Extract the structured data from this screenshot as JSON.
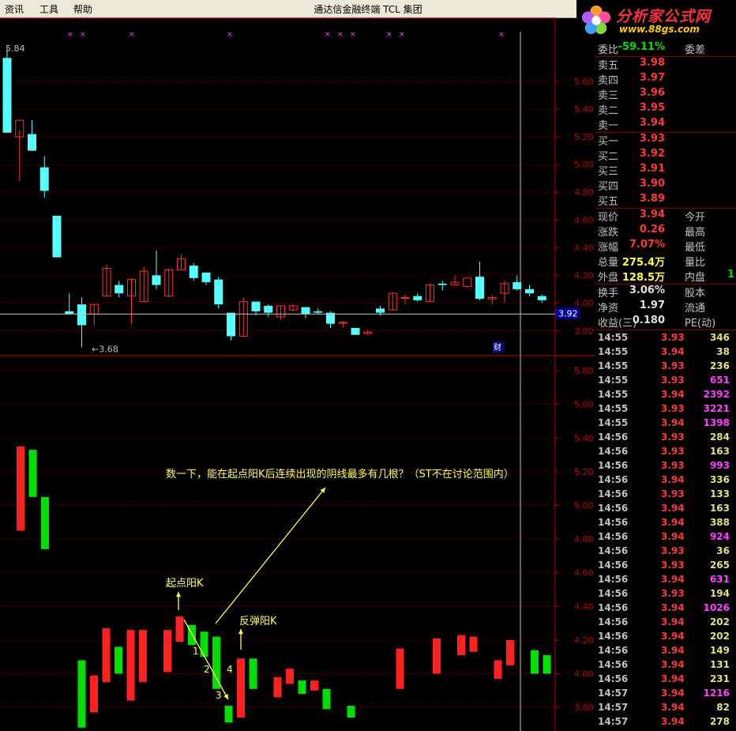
{
  "menu": [
    "资讯",
    "工具",
    "帮助"
  ],
  "app_title": "通达信金融终端  TCL 集团",
  "logo": {
    "brand": "分析家公式网",
    "url": "www.88gs.com"
  },
  "chart": {
    "top_pane": {
      "axis_ticks": [
        "5.60",
        "5.40",
        "5.20",
        "5.00",
        "4.80",
        "4.60",
        "4.40",
        "4.20",
        "4.00",
        "3.80"
      ],
      "axis_tick_values": [
        5.6,
        5.4,
        5.2,
        5.0,
        4.8,
        4.6,
        4.4,
        4.2,
        4.0,
        3.8
      ],
      "price_range": [
        3.62,
        5.92
      ],
      "high_label": "5.84",
      "low_label": "3.68",
      "current_price_tag": "3.92",
      "current_price": 3.92,
      "finance_marker": "财",
      "candles": [
        {
          "o": 5.77,
          "h": 5.84,
          "l": 5.23,
          "c": 5.23
        },
        {
          "o": 5.2,
          "h": 5.25,
          "l": 4.88,
          "c": 5.32
        },
        {
          "o": 5.22,
          "h": 5.32,
          "l": 5.17,
          "c": 5.1
        },
        {
          "o": 4.98,
          "h": 5.06,
          "l": 4.76,
          "c": 4.81
        },
        {
          "o": 4.63,
          "h": 4.63,
          "l": 4.33,
          "c": 4.33
        },
        {
          "o": 3.94,
          "h": 4.07,
          "l": 3.92,
          "c": 3.92
        },
        {
          "o": 3.99,
          "h": 4.04,
          "l": 3.68,
          "c": 3.84
        },
        {
          "o": 3.92,
          "h": 3.99,
          "l": 3.84,
          "c": 3.99
        },
        {
          "o": 4.05,
          "h": 4.28,
          "l": 4.05,
          "c": 4.25
        },
        {
          "o": 4.13,
          "h": 4.16,
          "l": 4.04,
          "c": 4.07
        },
        {
          "o": 4.05,
          "h": 4.18,
          "l": 3.85,
          "c": 4.17
        },
        {
          "o": 4.01,
          "h": 4.26,
          "l": 4.01,
          "c": 4.23
        },
        {
          "o": 4.2,
          "h": 4.38,
          "l": 4.1,
          "c": 4.13
        },
        {
          "o": 4.05,
          "h": 4.25,
          "l": 4.04,
          "c": 4.24
        },
        {
          "o": 4.24,
          "h": 4.35,
          "l": 4.24,
          "c": 4.32
        },
        {
          "o": 4.27,
          "h": 4.29,
          "l": 4.16,
          "c": 4.18
        },
        {
          "o": 4.22,
          "h": 4.2,
          "l": 4.13,
          "c": 4.15
        },
        {
          "o": 4.17,
          "h": 4.19,
          "l": 3.96,
          "c": 3.99
        },
        {
          "o": 3.93,
          "h": 3.93,
          "l": 3.73,
          "c": 3.76
        },
        {
          "o": 3.76,
          "h": 4.04,
          "l": 3.76,
          "c": 4.01
        },
        {
          "o": 4.01,
          "h": 4.01,
          "l": 3.91,
          "c": 3.94
        },
        {
          "o": 3.98,
          "h": 3.99,
          "l": 3.9,
          "c": 3.93
        },
        {
          "o": 3.9,
          "h": 3.98,
          "l": 3.88,
          "c": 3.98
        },
        {
          "o": 3.95,
          "h": 3.99,
          "l": 3.94,
          "c": 3.98
        },
        {
          "o": 3.97,
          "h": 3.96,
          "l": 3.89,
          "c": 3.92
        },
        {
          "o": 3.94,
          "h": 3.96,
          "l": 3.92,
          "c": 3.93
        },
        {
          "o": 3.93,
          "h": 3.94,
          "l": 3.82,
          "c": 3.85
        },
        {
          "o": 3.86,
          "h": 3.87,
          "l": 3.82,
          "c": 3.86
        },
        {
          "o": 3.82,
          "h": 3.82,
          "l": 3.77,
          "c": 3.77
        },
        {
          "o": 3.78,
          "h": 3.81,
          "l": 3.77,
          "c": 3.79
        },
        {
          "o": 3.96,
          "h": 3.98,
          "l": 3.91,
          "c": 3.93
        },
        {
          "o": 3.95,
          "h": 4.08,
          "l": 3.95,
          "c": 4.07
        },
        {
          "o": 4.04,
          "h": 4.06,
          "l": 3.99,
          "c": 4.04
        },
        {
          "o": 4.05,
          "h": 4.07,
          "l": 4.01,
          "c": 4.02
        },
        {
          "o": 4.01,
          "h": 4.14,
          "l": 4.01,
          "c": 4.13
        },
        {
          "o": 4.14,
          "h": 4.16,
          "l": 4.09,
          "c": 4.13
        },
        {
          "o": 4.13,
          "h": 4.2,
          "l": 4.13,
          "c": 4.15
        },
        {
          "o": 4.12,
          "h": 4.12,
          "l": 4.11,
          "c": 4.18
        },
        {
          "o": 4.19,
          "h": 4.3,
          "l": 4.02,
          "c": 4.03
        },
        {
          "o": 4.03,
          "h": 4.06,
          "l": 3.99,
          "c": 4.04
        },
        {
          "o": 4.07,
          "h": 4.16,
          "l": 4.0,
          "c": 4.14
        },
        {
          "o": 4.15,
          "h": 4.2,
          "l": 4.09,
          "c": 4.1
        },
        {
          "o": 4.1,
          "h": 4.13,
          "l": 4.05,
          "c": 4.07
        },
        {
          "o": 4.05,
          "h": 4.06,
          "l": 4.0,
          "c": 4.02
        }
      ]
    },
    "bottom_pane": {
      "axis_ticks": [
        "5.80",
        "5.60",
        "5.40",
        "5.20",
        "5.00",
        "4.80",
        "4.60",
        "4.40",
        "4.20",
        "4.00",
        "3.80"
      ],
      "axis_tick_values": [
        5.8,
        5.6,
        5.4,
        5.2,
        5.0,
        4.8,
        4.6,
        4.4,
        4.2,
        4.0,
        3.8
      ],
      "price_range": [
        3.66,
        5.88
      ],
      "bars": [
        {
          "top": 5.35,
          "bottom": 4.85,
          "color": "red"
        },
        {
          "top": 5.33,
          "bottom": 5.05,
          "color": "green"
        },
        {
          "top": 5.05,
          "bottom": 4.74,
          "color": "green"
        },
        null,
        null,
        {
          "top": 4.08,
          "bottom": 3.68,
          "color": "green"
        },
        {
          "top": 3.99,
          "bottom": 3.77,
          "color": "red"
        },
        {
          "top": 4.27,
          "bottom": 3.95,
          "color": "red"
        },
        {
          "top": 4.16,
          "bottom": 4.0,
          "color": "green"
        },
        {
          "top": 4.26,
          "bottom": 3.84,
          "color": "red"
        },
        {
          "top": 4.26,
          "bottom": 3.95,
          "color": "red"
        },
        null,
        {
          "top": 4.26,
          "bottom": 4.01,
          "color": "red"
        },
        {
          "top": 4.34,
          "bottom": 4.19,
          "color": "red"
        },
        {
          "top": 4.29,
          "bottom": 4.17,
          "color": "green"
        },
        {
          "top": 4.25,
          "bottom": 4.1,
          "color": "green"
        },
        {
          "top": 4.22,
          "bottom": 3.91,
          "color": "green"
        },
        {
          "top": 3.81,
          "bottom": 3.71,
          "color": "green"
        },
        {
          "top": 4.09,
          "bottom": 3.74,
          "color": "red"
        },
        {
          "top": 4.09,
          "bottom": 3.91,
          "color": "green"
        },
        null,
        {
          "top": 3.98,
          "bottom": 3.86,
          "color": "red"
        },
        {
          "top": 4.03,
          "bottom": 3.94,
          "color": "red"
        },
        {
          "top": 3.96,
          "bottom": 3.88,
          "color": "green"
        },
        {
          "top": 3.96,
          "bottom": 3.9,
          "color": "red"
        },
        {
          "top": 3.91,
          "bottom": 3.79,
          "color": "green"
        },
        null,
        {
          "top": 3.81,
          "bottom": 3.74,
          "color": "green"
        },
        null,
        null,
        null,
        {
          "top": 4.15,
          "bottom": 3.91,
          "color": "red"
        },
        null,
        null,
        {
          "top": 4.21,
          "bottom": 4.0,
          "color": "red"
        },
        null,
        {
          "top": 4.23,
          "bottom": 4.11,
          "color": "red"
        },
        {
          "top": 4.22,
          "bottom": 4.13,
          "color": "red"
        },
        null,
        {
          "top": 4.08,
          "bottom": 3.97,
          "color": "red"
        },
        {
          "top": 4.2,
          "bottom": 4.05,
          "color": "red"
        },
        null,
        {
          "top": 4.14,
          "bottom": 4.0,
          "color": "green"
        },
        {
          "top": 4.11,
          "bottom": 4.0,
          "color": "green"
        }
      ]
    },
    "annotations": {
      "question": "数一下，能在起点阳K后连续出现的阴线最多有几根？（ST不在讨论范围内）",
      "start_label": "起点阳K",
      "rebound_label": "反弹阳K",
      "counts": [
        "1",
        "2",
        "3",
        "4"
      ]
    },
    "colors": {
      "up": "#ff2020",
      "down": "#00e000",
      "candle_up": "#ff3030",
      "candle_down": "#54ffff",
      "axis": "#c00000",
      "annotation": "#ffff50"
    }
  },
  "quote": {
    "header": {
      "label": "委比",
      "value": "-59.11%",
      "label2": "委差"
    },
    "asks": [
      {
        "label": "卖五",
        "price": "3.98"
      },
      {
        "label": "卖四",
        "price": "3.97"
      },
      {
        "label": "卖三",
        "price": "3.96"
      },
      {
        "label": "卖二",
        "price": "3.95"
      },
      {
        "label": "卖一",
        "price": "3.94"
      }
    ],
    "bids": [
      {
        "label": "买一",
        "price": "3.93"
      },
      {
        "label": "买二",
        "price": "3.92"
      },
      {
        "label": "买三",
        "price": "3.91"
      },
      {
        "label": "买四",
        "price": "3.90"
      },
      {
        "label": "买五",
        "price": "3.89"
      }
    ],
    "stats": [
      {
        "label": "现价",
        "value": "3.94",
        "label2": "今开",
        "value2": ""
      },
      {
        "label": "涨跌",
        "value": "0.26",
        "label2": "最高",
        "value2": ""
      },
      {
        "label": "涨幅",
        "value": "7.07%",
        "label2": "最低",
        "value2": ""
      },
      {
        "label": "总量",
        "value": "275.4万",
        "label2": "量比",
        "value2": ""
      },
      {
        "label": "外盘",
        "value": "128.5万",
        "label2": "内盘",
        "value2": "1"
      }
    ],
    "stats2": [
      {
        "label": "换手",
        "value": "3.06%",
        "label2": "股本"
      },
      {
        "label": "净资",
        "value": "1.97",
        "label2": "流通"
      },
      {
        "label": "收益(三)",
        "value": "0.180",
        "label2": "PE(动)"
      }
    ],
    "ticks": [
      {
        "time": "14:55",
        "price": "3.93",
        "vol": "346",
        "pc": "red",
        "vc": "yel"
      },
      {
        "time": "14:55",
        "price": "3.94",
        "vol": "38",
        "pc": "red",
        "vc": "yel"
      },
      {
        "time": "14:55",
        "price": "3.93",
        "vol": "236",
        "pc": "red",
        "vc": "yel"
      },
      {
        "time": "14:55",
        "price": "3.93",
        "vol": "651",
        "pc": "red",
        "vc": "mag"
      },
      {
        "time": "14:55",
        "price": "3.94",
        "vol": "2392",
        "pc": "red",
        "vc": "mag"
      },
      {
        "time": "14:55",
        "price": "3.93",
        "vol": "3221",
        "pc": "red",
        "vc": "mag"
      },
      {
        "time": "14:55",
        "price": "3.94",
        "vol": "1398",
        "pc": "red",
        "vc": "mag"
      },
      {
        "time": "14:56",
        "price": "3.93",
        "vol": "284",
        "pc": "red",
        "vc": "yel"
      },
      {
        "time": "14:56",
        "price": "3.93",
        "vol": "163",
        "pc": "red",
        "vc": "yel"
      },
      {
        "time": "14:56",
        "price": "3.93",
        "vol": "993",
        "pc": "red",
        "vc": "mag"
      },
      {
        "time": "14:56",
        "price": "3.94",
        "vol": "336",
        "pc": "red",
        "vc": "yel"
      },
      {
        "time": "14:56",
        "price": "3.93",
        "vol": "133",
        "pc": "red",
        "vc": "yel"
      },
      {
        "time": "14:56",
        "price": "3.94",
        "vol": "163",
        "pc": "red",
        "vc": "yel"
      },
      {
        "time": "14:56",
        "price": "3.94",
        "vol": "388",
        "pc": "red",
        "vc": "yel"
      },
      {
        "time": "14:56",
        "price": "3.94",
        "vol": "924",
        "pc": "red",
        "vc": "mag"
      },
      {
        "time": "14:56",
        "price": "3.93",
        "vol": "36",
        "pc": "red",
        "vc": "yel"
      },
      {
        "time": "14:56",
        "price": "3.93",
        "vol": "265",
        "pc": "red",
        "vc": "yel"
      },
      {
        "time": "14:56",
        "price": "3.94",
        "vol": "631",
        "pc": "red",
        "vc": "mag"
      },
      {
        "time": "14:56",
        "price": "3.93",
        "vol": "194",
        "pc": "red",
        "vc": "yel"
      },
      {
        "time": "14:56",
        "price": "3.94",
        "vol": "1026",
        "pc": "red",
        "vc": "mag"
      },
      {
        "time": "14:56",
        "price": "3.94",
        "vol": "202",
        "pc": "red",
        "vc": "yel"
      },
      {
        "time": "14:56",
        "price": "3.94",
        "vol": "202",
        "pc": "red",
        "vc": "yel"
      },
      {
        "time": "14:56",
        "price": "3.94",
        "vol": "149",
        "pc": "red",
        "vc": "yel"
      },
      {
        "time": "14:56",
        "price": "3.94",
        "vol": "131",
        "pc": "red",
        "vc": "yel"
      },
      {
        "time": "14:56",
        "price": "3.94",
        "vol": "231",
        "pc": "red",
        "vc": "yel"
      },
      {
        "time": "14:57",
        "price": "3.94",
        "vol": "1216",
        "pc": "red",
        "vc": "mag"
      },
      {
        "time": "14:57",
        "price": "3.94",
        "vol": "82",
        "pc": "red",
        "vc": "yel"
      },
      {
        "time": "14:57",
        "price": "3.94",
        "vol": "278",
        "pc": "red",
        "vc": "yel"
      }
    ]
  }
}
